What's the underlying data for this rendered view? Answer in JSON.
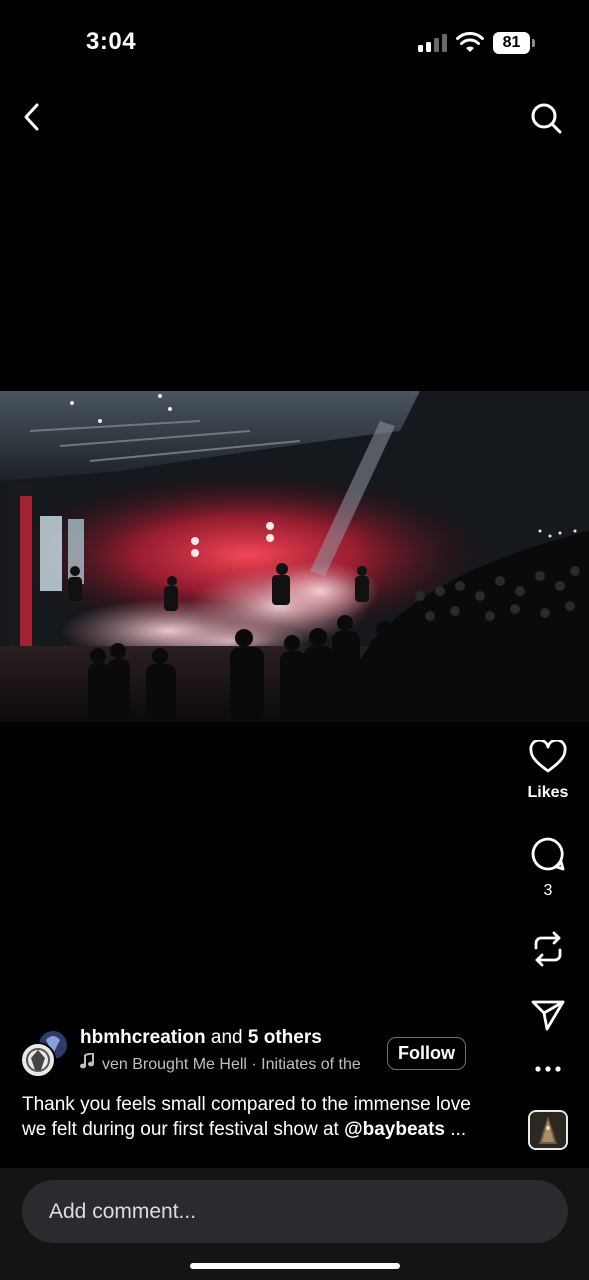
{
  "status_bar": {
    "time": "3:04",
    "battery_percent": "81",
    "signal_bars_filled": 2,
    "signal_bars_total": 4
  },
  "nav": {
    "back_icon": "chevron-left-icon",
    "search_icon": "search-icon"
  },
  "post": {
    "media_description_icon": "concert-photo",
    "author": {
      "username": "hbmhcreation",
      "and_text": "and",
      "others": "5 others"
    },
    "music": {
      "icon": "music-note-icon",
      "track_text": "ven Brought Me Hell · Initiates of the"
    },
    "follow_label": "Follow",
    "caption": {
      "text": "Thank you feels small compared to the immense love we felt during our first festival show at ",
      "mention": "@baybeats",
      "ellipsis": " ..."
    }
  },
  "actions": {
    "likes_label": "Likes",
    "comments_count": "3",
    "like_icon": "heart-icon",
    "comment_icon": "comment-bubble-icon",
    "repost_icon": "repost-icon",
    "share_icon": "send-icon",
    "more_icon": "more-horizontal-icon"
  },
  "comment_bar": {
    "placeholder": "Add comment..."
  },
  "colors": {
    "background": "#000000",
    "input_bg": "#2a2b2e",
    "stage_red": "#e0283c"
  }
}
